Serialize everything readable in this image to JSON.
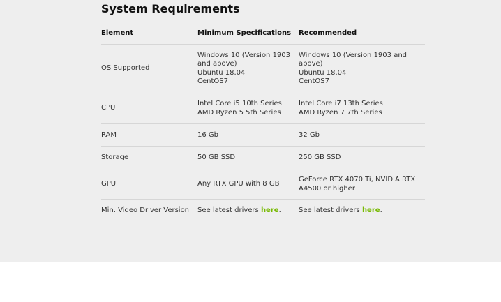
{
  "section": {
    "title": "System Requirements"
  },
  "table": {
    "headers": [
      "Element",
      "Minimum Specifications",
      "Recommended"
    ],
    "rows": [
      {
        "element": "OS Supported",
        "minimum": [
          "Windows 10 (Version 1903",
          "and above)",
          "Ubuntu 18.04",
          "CentOS7"
        ],
        "recommended": [
          "Windows 10 (Version 1903 and",
          "above)",
          "Ubuntu 18.04",
          "CentOS7"
        ]
      },
      {
        "element": "CPU",
        "minimum": [
          "Intel Core i5 10th Series",
          "AMD Ryzen 5 5th Series"
        ],
        "recommended": [
          "Intel Core i7 13th Series",
          "AMD Ryzen 7 7th Series"
        ]
      },
      {
        "element": "RAM",
        "minimum": [
          "16 Gb"
        ],
        "recommended": [
          "32 Gb"
        ]
      },
      {
        "element": "Storage",
        "minimum": [
          "50 GB SSD"
        ],
        "recommended": [
          "250 GB SSD"
        ]
      },
      {
        "element": "GPU",
        "minimum": [
          "Any RTX GPU with 8 GB"
        ],
        "recommended": [
          "GeForce RTX 4070 Ti, NVIDIA RTX",
          "A4500 or higher"
        ]
      },
      {
        "element": "Min. Video Driver Version",
        "minimum_prefix": "See latest drivers ",
        "minimum_link": "here",
        "minimum_suffix": ".",
        "recommended_prefix": "See latest drivers ",
        "recommended_link": "here",
        "recommended_suffix": "."
      }
    ]
  },
  "colors": {
    "section_background": "#eeeeee",
    "link_accent": "#76b900",
    "divider": "#d6d6d6"
  }
}
